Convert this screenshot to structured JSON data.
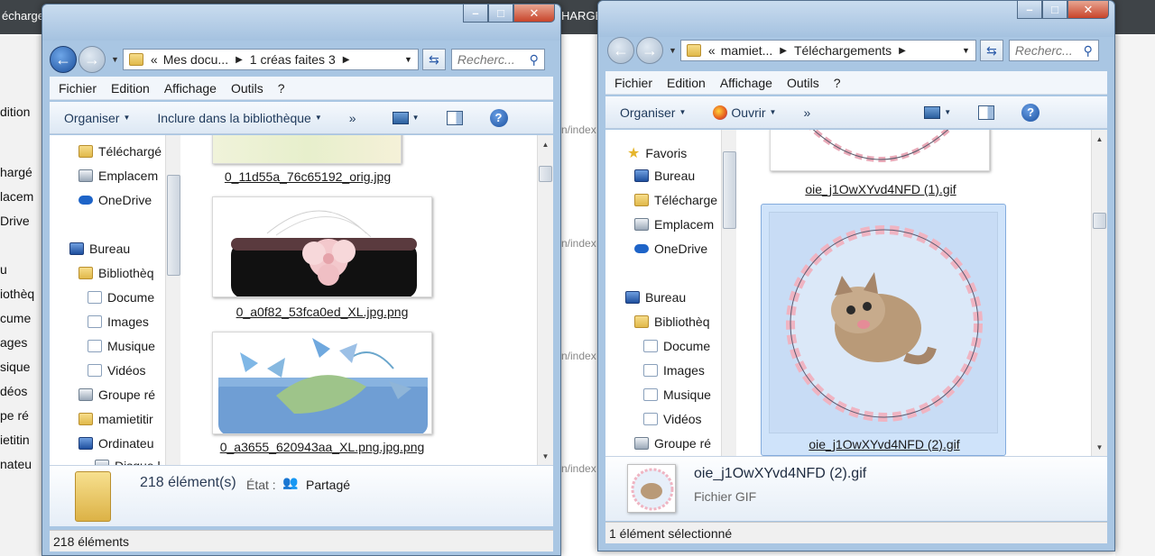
{
  "background": {
    "top_text_left": "échargement",
    "top_text_mid": "HARGE",
    "left_items": [
      "dition",
      "hargé",
      "lacem",
      "Drive",
      "u",
      "iothèq",
      "cume",
      "ages",
      "sique",
      "déos",
      "pe ré",
      "ietitin",
      "nateu"
    ],
    "mid_items": [
      "n/index",
      "n/index",
      "n/index",
      "n/index",
      "n/index",
      "n/index"
    ]
  },
  "window1": {
    "address": {
      "p1": "Mes docu...",
      "p2": "1 créas faites 3",
      "prefix": "«"
    },
    "search_placeholder": "Recherc...",
    "menu": [
      "Fichier",
      "Edition",
      "Affichage",
      "Outils",
      "?"
    ],
    "toolbar": {
      "organize": "Organiser",
      "library": "Inclure dans la bibliothèque",
      "more": "»"
    },
    "tree": [
      {
        "label": "Téléchargé",
        "icon": "folder"
      },
      {
        "label": "Emplacem",
        "icon": "drive"
      },
      {
        "label": "OneDrive",
        "icon": "cloud"
      },
      {
        "label": "Bureau",
        "icon": "monitor"
      },
      {
        "label": "Bibliothèq",
        "icon": "folder"
      },
      {
        "label": "Docume",
        "icon": "doc"
      },
      {
        "label": "Images",
        "icon": "doc"
      },
      {
        "label": "Musique",
        "icon": "doc"
      },
      {
        "label": "Vidéos",
        "icon": "doc"
      },
      {
        "label": "Groupe ré",
        "icon": "drive"
      },
      {
        "label": "mamietitir",
        "icon": "folder"
      },
      {
        "label": "Ordinateu",
        "icon": "monitor"
      },
      {
        "label": "Disque l",
        "icon": "drive"
      }
    ],
    "files": [
      "0_11d55a_76c65192_orig.jpg",
      "0_a0f82_53fca0ed_XL.jpg.png",
      "0_a3655_620943aa_XL.png.jpg.png"
    ],
    "details": {
      "count": "218 élément(s)",
      "state_label": "État :",
      "state_value": "Partagé"
    },
    "status": "218 éléments"
  },
  "window2": {
    "address": {
      "p1": "mamiet...",
      "p2": "Téléchargements",
      "prefix": "«"
    },
    "search_placeholder": "Recherc...",
    "menu": [
      "Fichier",
      "Edition",
      "Affichage",
      "Outils",
      "?"
    ],
    "toolbar": {
      "organize": "Organiser",
      "open": "Ouvrir",
      "more": "»"
    },
    "tree": [
      {
        "label": "Favoris",
        "icon": "star"
      },
      {
        "label": "Bureau",
        "icon": "monitor"
      },
      {
        "label": "Télécharge",
        "icon": "folder"
      },
      {
        "label": "Emplacem",
        "icon": "drive"
      },
      {
        "label": "OneDrive",
        "icon": "cloud"
      },
      {
        "label": "Bureau",
        "icon": "monitor"
      },
      {
        "label": "Bibliothèq",
        "icon": "folder"
      },
      {
        "label": "Docume",
        "icon": "doc"
      },
      {
        "label": "Images",
        "icon": "doc"
      },
      {
        "label": "Musique",
        "icon": "doc"
      },
      {
        "label": "Vidéos",
        "icon": "doc"
      },
      {
        "label": "Groupe ré",
        "icon": "drive"
      }
    ],
    "files": [
      "oie_j1OwXYvd4NFD (1).gif",
      "oie_j1OwXYvd4NFD (2).gif"
    ],
    "details": {
      "name": "oie_j1OwXYvd4NFD (2).gif",
      "type": "Fichier GIF"
    },
    "status": "1 élément sélectionné"
  },
  "colors": {
    "selection": "#cfe3fa",
    "accent": "#2a5aa8"
  }
}
